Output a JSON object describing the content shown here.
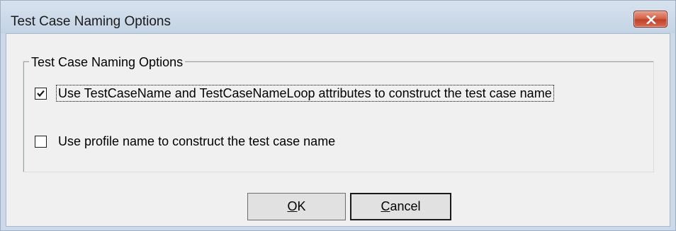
{
  "window": {
    "title": "Test Case Naming Options"
  },
  "group": {
    "legend": "Test Case Naming Options"
  },
  "options": [
    {
      "label": "Use TestCaseName and TestCaseNameLoop attributes to construct the test case name",
      "checked": true
    },
    {
      "label": "Use profile name to construct the test case name",
      "checked": false
    }
  ],
  "buttons": {
    "ok_label": "OK",
    "cancel_label": "Cancel"
  },
  "icons": {
    "close": "close-icon",
    "check": "checkmark-icon"
  },
  "colors": {
    "close_button": "#c9553b",
    "titlebar": "#cdd9e8",
    "client_bg": "#f0f0f0"
  }
}
